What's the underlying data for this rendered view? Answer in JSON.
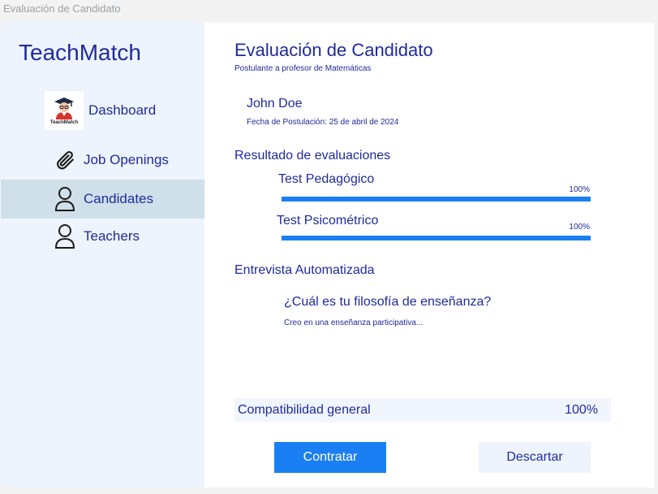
{
  "window": {
    "title": "Evaluación de Candidato"
  },
  "sidebar": {
    "brand": "TeachMatch",
    "logo_text": "TeachMatch",
    "items": [
      {
        "label": "Dashboard",
        "icon": "teacher-avatar-icon",
        "active": false
      },
      {
        "label": "Job Openings",
        "icon": "paperclip-icon",
        "active": false
      },
      {
        "label": "Candidates",
        "icon": "person-icon",
        "active": true
      },
      {
        "label": "Teachers",
        "icon": "person-icon",
        "active": false
      }
    ]
  },
  "main": {
    "title": "Evaluación de Candidato",
    "subtitle": "Postulante a profesor de Matemáticas",
    "candidate": {
      "name": "John Doe",
      "date": "Fecha de Postulación: 25 de abril de 2024"
    },
    "results_heading": "Resultado de evaluaciones",
    "tests": [
      {
        "label": "Test Pedagógico",
        "percent_label": "100%",
        "fill": 1.0
      },
      {
        "label": "Test Psicométrico",
        "percent_label": "100%",
        "fill": 1.0
      }
    ],
    "interview_heading": "Entrevista Automatizada",
    "question": "¿Cuál es tu filosofía de enseñanza?",
    "answer": "Creo en una enseñanza participativa...",
    "compatibility": {
      "label": "Compatibilidad general",
      "value": "100%"
    },
    "actions": {
      "hire": "Contratar",
      "discard": "Descartar"
    }
  },
  "colors": {
    "accent": "#1a7ff2",
    "text": "#1f2a9c",
    "sidebar_bg": "#eef4fe",
    "active_item_bg": "#d0e0ea"
  }
}
